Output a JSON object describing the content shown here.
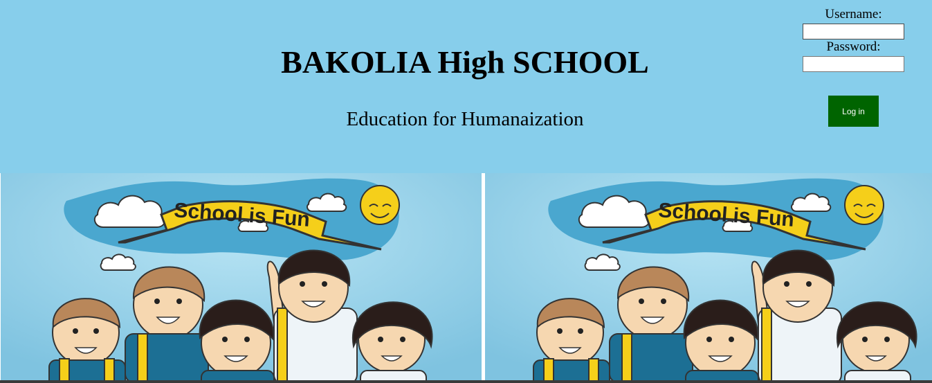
{
  "header": {
    "title": "BAKOLIA High SCHOOL",
    "slogan": "Education for Humanaization"
  },
  "login": {
    "username_label": "Username:",
    "username_value": "",
    "password_label": "Password:",
    "password_value": "",
    "button_label": "Log in"
  },
  "banner": {
    "image_text": "School is Fun",
    "panels": 2
  },
  "colors": {
    "page_background": "#87ceeb",
    "login_button": "#006400",
    "banner_sky": "#9fd6ec",
    "cloud_band": "#4aa7cf",
    "ribbon": "#f5cf1a"
  }
}
